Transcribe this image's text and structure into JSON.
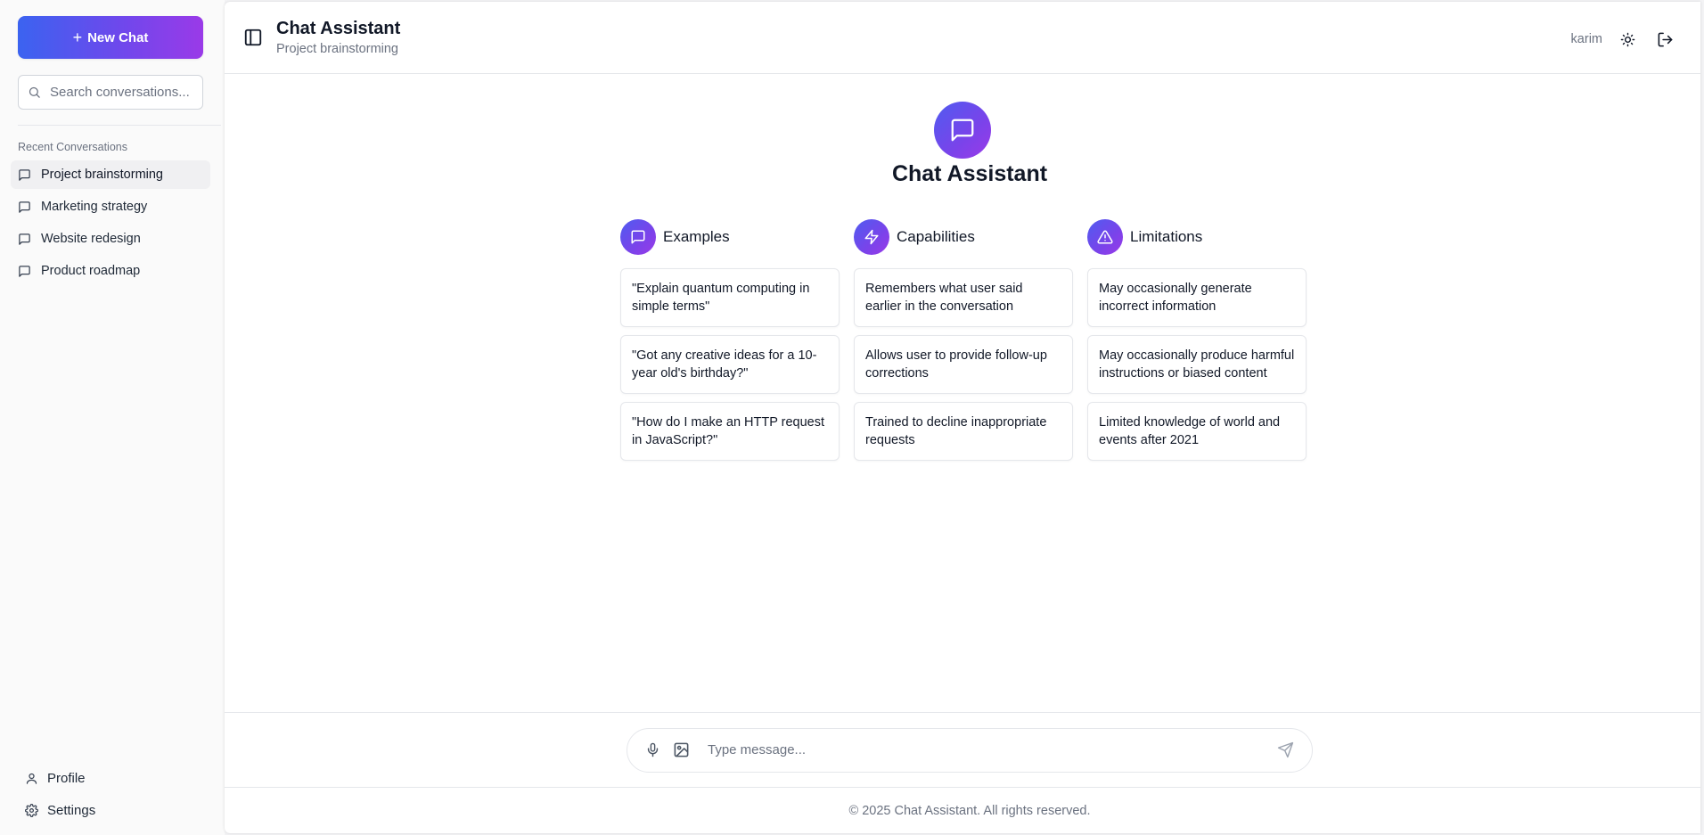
{
  "sidebar": {
    "new_chat_label": "New Chat",
    "search_placeholder": "Search conversations...",
    "recent_title": "Recent Conversations",
    "conversations": [
      {
        "label": "Project brainstorming",
        "active": true
      },
      {
        "label": "Marketing strategy",
        "active": false
      },
      {
        "label": "Website redesign",
        "active": false
      },
      {
        "label": "Product roadmap",
        "active": false
      }
    ],
    "bottom": {
      "profile_label": "Profile",
      "settings_label": "Settings"
    }
  },
  "header": {
    "title": "Chat Assistant",
    "subtitle": "Project brainstorming",
    "username": "karim",
    "icons": [
      "sidebar-toggle-icon",
      "sun-icon",
      "logout-icon"
    ]
  },
  "welcome": {
    "title": "Chat Assistant",
    "columns": [
      {
        "title": "Examples",
        "icon": "chat-bubble-icon",
        "cards": [
          "\"Explain quantum computing in simple terms\"",
          "\"Got any creative ideas for a 10-year old's birthday?\"",
          "\"How do I make an HTTP request in JavaScript?\""
        ]
      },
      {
        "title": "Capabilities",
        "icon": "lightning-icon",
        "cards": [
          "Remembers what user said earlier in the conversation",
          "Allows user to provide follow-up corrections",
          "Trained to decline inappropriate requests"
        ]
      },
      {
        "title": "Limitations",
        "icon": "warning-icon",
        "cards": [
          "May occasionally generate incorrect information",
          "May occasionally produce harmful instructions or biased content",
          "Limited knowledge of world and events after 2021"
        ]
      }
    ]
  },
  "composer": {
    "placeholder": "Type message...",
    "icons": [
      "microphone-icon",
      "image-icon",
      "send-icon"
    ]
  },
  "footer": {
    "text": "© 2025 Chat Assistant. All rights reserved."
  },
  "colors": {
    "gradient_start": "#3b63f0",
    "gradient_end": "#9a3ae8",
    "sidebar_bg": "#fafafa",
    "active_item_bg": "#f0f0f2"
  }
}
